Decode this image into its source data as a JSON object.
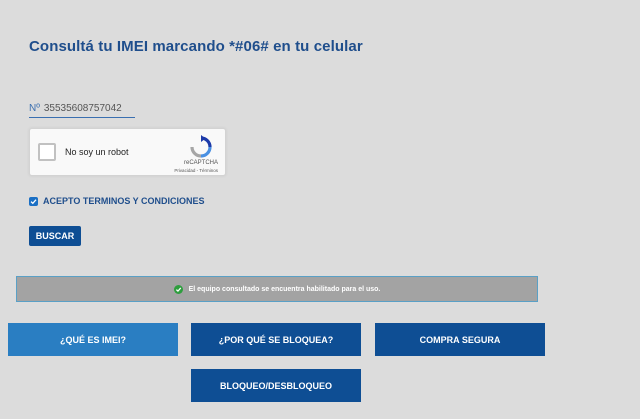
{
  "title": "Consultá tu IMEI marcando *#06# en tu celular",
  "imei": {
    "prefix": "Nº",
    "value": "35535608757042"
  },
  "recaptcha": {
    "label": "No soy un robot",
    "brand": "reCAPTCHA",
    "links": "Privacidad - Términos",
    "checked": false
  },
  "terms": {
    "label": "ACEPTO TERMINOS Y CONDICIONES",
    "checked": true
  },
  "search_button": "BUSCAR",
  "result": {
    "message": "El equipo consultado se encuentra habilitado para el uso.",
    "status": "ok"
  },
  "nav": {
    "que_es_imei": "¿QUÉ ES IMEI?",
    "por_que_bloquea": "¿POR QUÉ SE BLOQUEA?",
    "compra_segura": "COMPRA SEGURA",
    "bloqueo": "BLOQUEO/DESBLOQUEO"
  },
  "colors": {
    "primary": "#0e4e94",
    "primary_light": "#2a7ec2",
    "title": "#1f4e8c",
    "success": "#2e9e3e",
    "result_bg": "#a3a3a3",
    "page_bg": "#dcdcdc"
  },
  "icons": {
    "check": "check-icon",
    "success": "check-circle-icon",
    "captcha": "recaptcha-logo-icon"
  }
}
